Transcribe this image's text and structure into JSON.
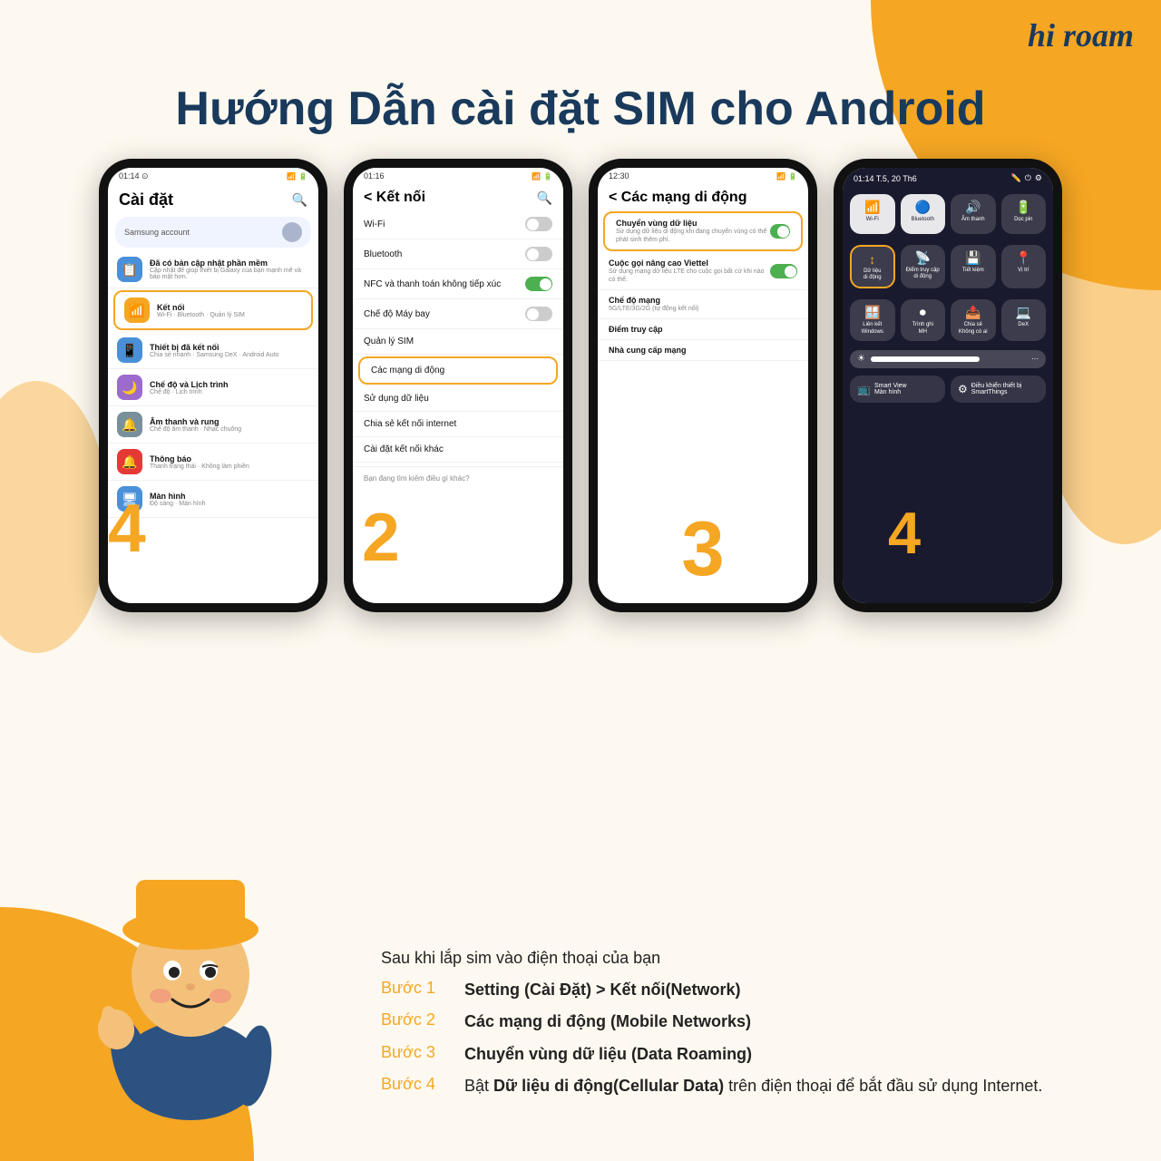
{
  "brand": {
    "logo": "hi roam",
    "logo_hi": "hi",
    "logo_roam": "roam"
  },
  "title": "Hướng Dẫn cài đặt SIM cho Android",
  "phones": {
    "phone1": {
      "status_time": "01:14",
      "screen_title": "Cài đặt",
      "samsung_account": "Samsung account",
      "items": [
        {
          "icon": "📋",
          "icon_color": "blue",
          "title": "Đã có bản cập nhật phần mềm",
          "sub": "Cập nhật để giúp thiết bị Galaxy của bạn mạnh mẽ và bảo mật hơn.",
          "highlighted": false
        },
        {
          "icon": "📶",
          "icon_color": "orange",
          "title": "Kết nối",
          "sub": "Wi-Fi · Bluetooth · Quản lý SIM",
          "highlighted": true
        },
        {
          "icon": "📱",
          "icon_color": "blue",
          "title": "Thiết bị đã kết nối",
          "sub": "Chia sẻ nhanh · Samsung DeX · Android Auto",
          "highlighted": false
        },
        {
          "icon": "🌙",
          "icon_color": "purple",
          "title": "Chế độ và Lịch trình",
          "sub": "Chế độ · Lịch trình",
          "highlighted": false
        },
        {
          "icon": "🔔",
          "icon_color": "gray",
          "title": "Âm thanh và rung",
          "sub": "Chế độ âm thanh · Nhạc chuông",
          "highlighted": false
        },
        {
          "icon": "🔔",
          "icon_color": "red",
          "title": "Thông báo",
          "sub": "Thanh trạng thái · Không làm phiền",
          "highlighted": false
        },
        {
          "icon": "🖥",
          "icon_color": "blue",
          "title": "Màn hình",
          "sub": "",
          "highlighted": false
        }
      ],
      "step_number": "4"
    },
    "phone2": {
      "status_time": "01:16",
      "back_label": "< Kết nối",
      "items": [
        {
          "label": "Wi-Fi",
          "toggle": false,
          "highlighted": false
        },
        {
          "label": "Bluetooth",
          "toggle": false,
          "highlighted": false
        },
        {
          "label": "NFC và thanh toán không tiếp xúc",
          "toggle": true,
          "highlighted": false
        },
        {
          "label": "Chế độ Máy bay",
          "toggle": false,
          "highlighted": false
        },
        {
          "label": "Quản lý SIM",
          "toggle": null,
          "highlighted": false
        },
        {
          "label": "Các mạng di động",
          "toggle": null,
          "highlighted": true
        },
        {
          "label": "Sử dụng dữ liệu",
          "toggle": null,
          "highlighted": false
        },
        {
          "label": "Chia sẻ kết nối internet",
          "toggle": null,
          "highlighted": false
        },
        {
          "label": "Cài đặt kết nối khác",
          "toggle": null,
          "highlighted": false
        }
      ],
      "search_hint": "Bạn đang tìm kiếm điều gì khác?",
      "step_number": "2"
    },
    "phone3": {
      "status_time": "12:30",
      "back_label": "< Các mạng di động",
      "items": [
        {
          "title": "Chuyển vùng dữ liệu",
          "sub": "Sử dụng dữ liệu di động khi đang chuyển vùng có thể phát sinh thêm phí.",
          "toggle": true,
          "highlighted": true
        },
        {
          "title": "Cuộc gọi nâng cao Viettel",
          "sub": "Sử dụng mạng dữ liệu LTE cho cuộc gọi bất cứ khi nào có thể.",
          "toggle": true,
          "highlighted": false
        },
        {
          "title": "Chế độ mạng",
          "sub": "5G/LTE/3G/2G (tự động kết nối)",
          "toggle": null,
          "highlighted": false
        },
        {
          "title": "Điểm truy cập",
          "sub": "",
          "toggle": null,
          "highlighted": false
        },
        {
          "title": "Nhà cung cấp mạng",
          "sub": "",
          "toggle": null,
          "highlighted": false
        }
      ],
      "step_number": "3"
    },
    "phone4": {
      "status_time": "01:14 T.5, 20 Th6",
      "tiles_row1": [
        {
          "label": "Wi-Fi",
          "icon": "📶",
          "active": true
        },
        {
          "label": "Bluetooth",
          "icon": "🔷",
          "active": true
        },
        {
          "label": "Âm thanh",
          "icon": "🔊",
          "active": false
        },
        {
          "label": "Dọc pin",
          "icon": "🔋",
          "active": false
        }
      ],
      "tiles_row2": [
        {
          "label": "Dữ liệu di động",
          "icon": "↕",
          "active": false,
          "highlighted": true
        },
        {
          "label": "Điểm truy cập di động",
          "icon": "📡",
          "active": false
        },
        {
          "label": "Tiết kiệm",
          "icon": "💾",
          "active": false
        },
        {
          "label": "Vị trí",
          "icon": "📍",
          "active": false
        }
      ],
      "tiles_row3": [
        {
          "label": "Liên kết Windows",
          "icon": "🪟",
          "active": false
        },
        {
          "label": "Trình ghi MH",
          "icon": "⏺",
          "active": false
        },
        {
          "label": "Chia sẻ Không có ai",
          "icon": "📤",
          "active": false
        },
        {
          "label": "DeX",
          "icon": "💻",
          "active": false
        }
      ],
      "bottom_tiles": [
        {
          "label": "Smart View Màn hình"
        },
        {
          "label": "Điều khiển thiết bị SmartThings"
        }
      ],
      "step_number": "4"
    }
  },
  "instructions": {
    "intro": "Sau khi lắp sim vào điện thoại của bạn",
    "steps": [
      {
        "label": "Bước 1",
        "text": "Setting (Cài Đặt) > Kết nối(Network)"
      },
      {
        "label": "Bước 2",
        "text": "Các mạng di động (Mobile Networks)"
      },
      {
        "label": "Bước 3",
        "text": "Chuyển vùng dữ liệu (Data Roaming)"
      },
      {
        "label": "Bước 4",
        "text": "Bật Dữ liệu di động(Cellular Data) trên điện thoại để bắt đầu sử dụng Internet."
      }
    ]
  }
}
